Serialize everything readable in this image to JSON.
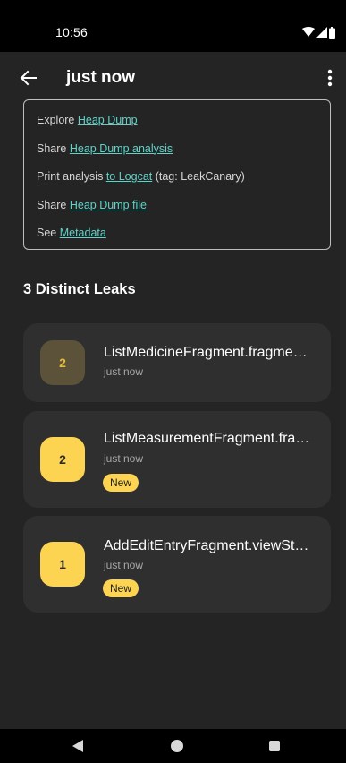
{
  "status_bar": {
    "time": "10:56"
  },
  "app_bar": {
    "title": "just now"
  },
  "links": [
    {
      "prefix": "Explore ",
      "link": "Heap Dump",
      "suffix": ""
    },
    {
      "prefix": "Share ",
      "link": "Heap Dump analysis",
      "suffix": ""
    },
    {
      "prefix": "Print analysis ",
      "link": "to Logcat",
      "suffix": " (tag: LeakCanary)"
    },
    {
      "prefix": "Share ",
      "link": "Heap Dump file",
      "suffix": ""
    },
    {
      "prefix": "See ",
      "link": "Metadata",
      "suffix": ""
    }
  ],
  "section_title": "3 Distinct Leaks",
  "leaks": [
    {
      "count": "2",
      "title": "ListMedicineFragment.fragme…",
      "time": "just now",
      "badge_new": ""
    },
    {
      "count": "2",
      "title": "ListMeasurementFragment.fra…",
      "time": "just now",
      "badge_new": "New"
    },
    {
      "count": "1",
      "title": "AddEditEntryFragment.viewSt…",
      "time": "just now",
      "badge_new": "New"
    }
  ],
  "colors": {
    "background": "#242424",
    "card": "#2f2f2f",
    "link": "#5fd3c8",
    "accent": "#fdd452",
    "badge_dim": "#5b5239"
  }
}
